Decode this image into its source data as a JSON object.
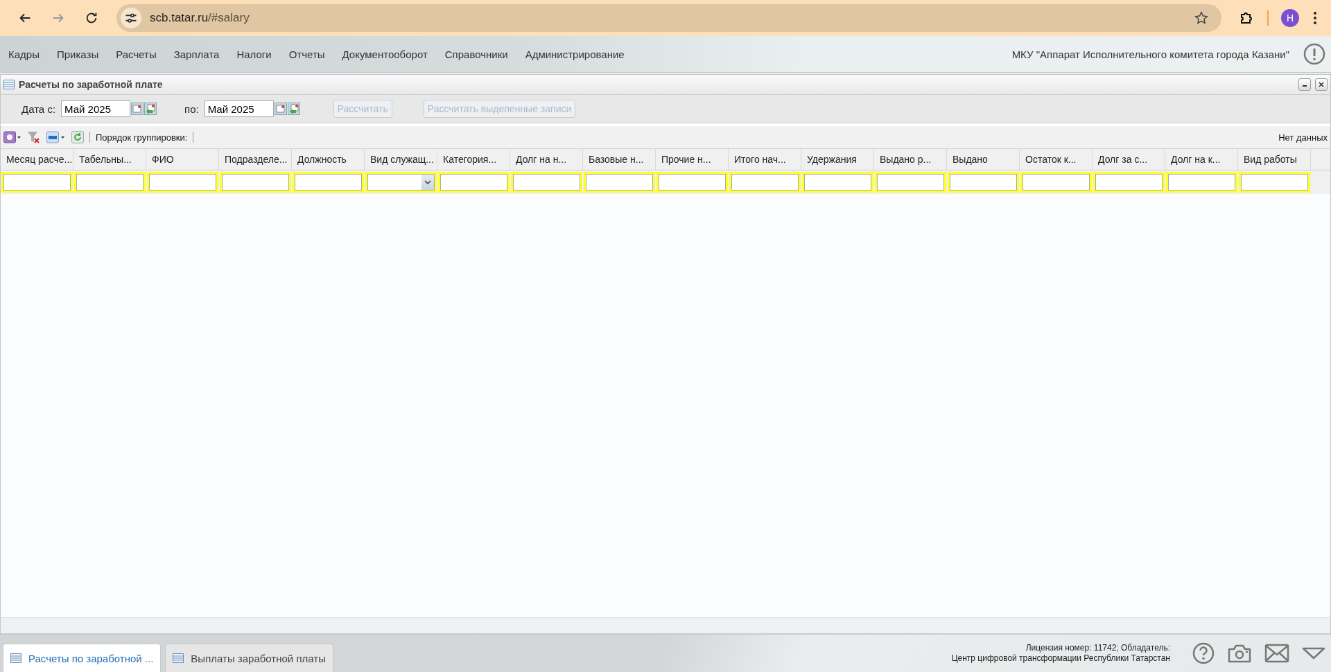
{
  "browser": {
    "url_host": "scb.tatar.ru",
    "url_path": "/#salary",
    "profile_initial": "Н"
  },
  "menu": {
    "items": [
      "Кадры",
      "Приказы",
      "Расчеты",
      "Зарплата",
      "Налоги",
      "Отчеты",
      "Документооборот",
      "Справочники",
      "Администрирование"
    ],
    "organization": "МКУ \"Аппарат Исполнительного комитета города Казани\""
  },
  "panel": {
    "title": "Расчеты по заработной плате",
    "date_from": {
      "label": "Дата с:",
      "value": "Май 2025"
    },
    "date_to": {
      "label": "по:",
      "value": "Май 2025"
    },
    "buttons": [
      {
        "label": "Рассчитать",
        "disabled": true
      },
      {
        "label": "Рассчитать выделенные записи",
        "disabled": true
      }
    ]
  },
  "grid_toolbar": {
    "grouping_label": "Порядок группировки:",
    "status": "Нет данных"
  },
  "table": {
    "columns": [
      {
        "label": "Месяц расче...",
        "kind": "text"
      },
      {
        "label": "Табельны...",
        "kind": "text"
      },
      {
        "label": "ФИО",
        "kind": "text"
      },
      {
        "label": "Подразделе...",
        "kind": "text"
      },
      {
        "label": "Должность",
        "kind": "text"
      },
      {
        "label": "Вид служащ...",
        "kind": "select"
      },
      {
        "label": "Категория...",
        "kind": "text"
      },
      {
        "label": "Долг на н...",
        "kind": "text"
      },
      {
        "label": "Базовые н...",
        "kind": "text"
      },
      {
        "label": "Прочие н...",
        "kind": "text"
      },
      {
        "label": "Итого нач...",
        "kind": "text"
      },
      {
        "label": "Удержания",
        "kind": "text"
      },
      {
        "label": "Выдано р...",
        "kind": "text"
      },
      {
        "label": "Выдано",
        "kind": "text"
      },
      {
        "label": "Остаток к...",
        "kind": "text"
      },
      {
        "label": "Долг за с...",
        "kind": "text"
      },
      {
        "label": "Долг на к...",
        "kind": "text"
      },
      {
        "label": "Вид работы",
        "kind": "text"
      }
    ]
  },
  "taskbar": {
    "tabs": [
      {
        "label": "Расчеты по заработной ...",
        "selected": true
      },
      {
        "label": "Выплаты заработной платы",
        "selected": false
      }
    ],
    "license": [
      "Лицензия номер: 11742; Обладатель:",
      "Центр цифровой трансформации Республики Татарстан"
    ]
  }
}
